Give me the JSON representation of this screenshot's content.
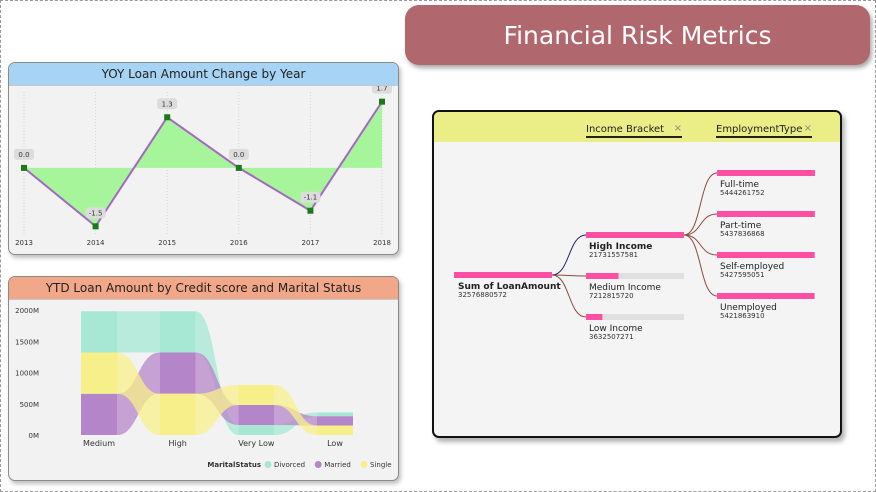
{
  "banner": {
    "title": "Financial Risk Metrics",
    "color": "#b0686e"
  },
  "yoy": {
    "title": "YOY Loan Amount Change by Year",
    "header_color": "#a7d3f5",
    "chart_data": {
      "type": "line",
      "title": "YOY Loan Amount Change by Year",
      "x": [
        "2013",
        "2014",
        "2015",
        "2016",
        "2017",
        "2018"
      ],
      "values": [
        0.0,
        -1.5,
        1.3,
        0.0,
        -1.1,
        1.7
      ],
      "labels": [
        "0.0",
        "-1.5",
        "1.3",
        "0.0",
        "-1.1",
        "1.7"
      ],
      "area_color": "#a6f59a",
      "line_color": "#a368c2",
      "marker_color": "#1a7a1a",
      "ylim": [
        -1.8,
        2.0
      ]
    }
  },
  "ytd": {
    "title": "YTD Loan Amount by Credit score and Marital Status",
    "header_color": "#f2a888",
    "chart_data": {
      "type": "area",
      "title": "YTD Loan Amount by Credit score and Marital Status",
      "categories": [
        "Medium",
        "High",
        "Very Low",
        "Low"
      ],
      "y_ticks": [
        "0M",
        "500M",
        "1000M",
        "1500M",
        "2000M"
      ],
      "ylim": [
        0,
        2000
      ],
      "legend_title": "MaritalStatus",
      "series": [
        {
          "name": "Divorced",
          "color": "#a6e8d4",
          "values": [
            660,
            660,
            160,
            60
          ]
        },
        {
          "name": "Married",
          "color": "#b585c9",
          "values": [
            660,
            660,
            320,
            150
          ]
        },
        {
          "name": "Single",
          "color": "#f7f08a",
          "values": [
            660,
            660,
            320,
            150
          ]
        }
      ],
      "order_by_category": [
        [
          "Married",
          "Single",
          "Divorced"
        ],
        [
          "Single",
          "Married",
          "Divorced"
        ],
        [
          "Divorced",
          "Married",
          "Single"
        ],
        [
          "Single",
          "Married",
          "Divorced"
        ]
      ]
    }
  },
  "tree": {
    "header_color": "#ebee86",
    "levels": [
      "Income Bracket",
      "EmploymentType"
    ],
    "close_glyph": "×",
    "bar_color": "#ff4fa3",
    "track_color": "#e0e0e0",
    "root": {
      "label": "Sum of LoanAmount",
      "value": "32576880572",
      "amount": 32576880572
    },
    "income": [
      {
        "label": "High Income",
        "value": "21731557581",
        "amount": 21731557581,
        "expanded": true
      },
      {
        "label": "Medium Income",
        "value": "7212815720",
        "amount": 7212815720,
        "expanded": false
      },
      {
        "label": "Low Income",
        "value": "3632507271",
        "amount": 3632507271,
        "expanded": false
      }
    ],
    "employment": [
      {
        "label": "Full-time",
        "value": "5444261752",
        "amount": 5444261752
      },
      {
        "label": "Part-time",
        "value": "5437836868",
        "amount": 5437836868
      },
      {
        "label": "Self-employed",
        "value": "5427595051",
        "amount": 5427595051
      },
      {
        "label": "Unemployed",
        "value": "5421863910",
        "amount": 5421863910
      }
    ]
  }
}
